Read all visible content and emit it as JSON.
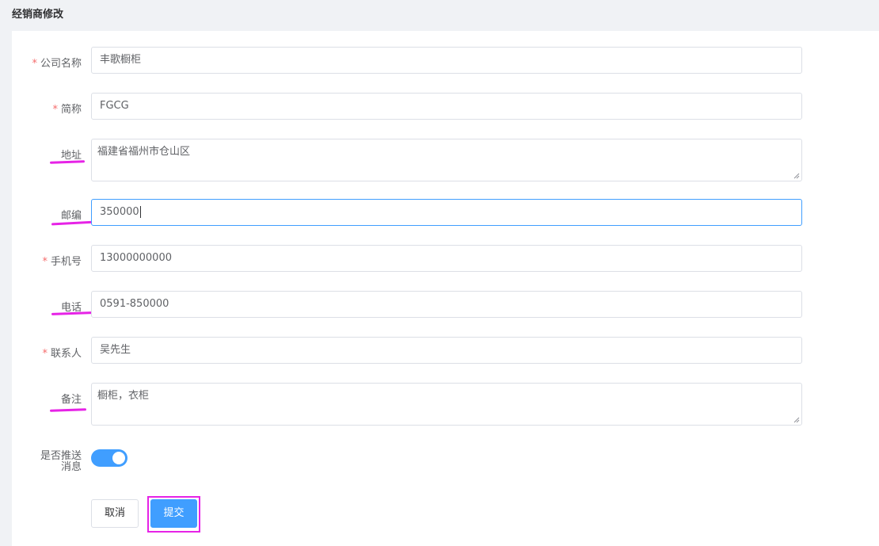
{
  "page": {
    "title": "经销商修改"
  },
  "form": {
    "company_name": {
      "label": "公司名称",
      "required": true,
      "value": "丰歌橱柜"
    },
    "short_name": {
      "label": "简称",
      "required": true,
      "value": "FGCG"
    },
    "address": {
      "label": "地址",
      "required": false,
      "value": "福建省福州市仓山区"
    },
    "postcode": {
      "label": "邮编",
      "required": false,
      "value": "350000"
    },
    "mobile": {
      "label": "手机号",
      "required": true,
      "value": "13000000000"
    },
    "phone": {
      "label": "电话",
      "required": false,
      "value": "0591-850000"
    },
    "contact": {
      "label": "联系人",
      "required": true,
      "value": "吴先生"
    },
    "remark": {
      "label": "备注",
      "required": false,
      "value": "橱柜，衣柜"
    },
    "push": {
      "label_line1": "是否推送",
      "label_line2": "消息",
      "enabled": true
    }
  },
  "required_mark": "*",
  "buttons": {
    "cancel": "取消",
    "submit": "提交"
  },
  "colors": {
    "accent": "#409eff",
    "annotation": "#e623e6",
    "required": "#f56c6c"
  }
}
